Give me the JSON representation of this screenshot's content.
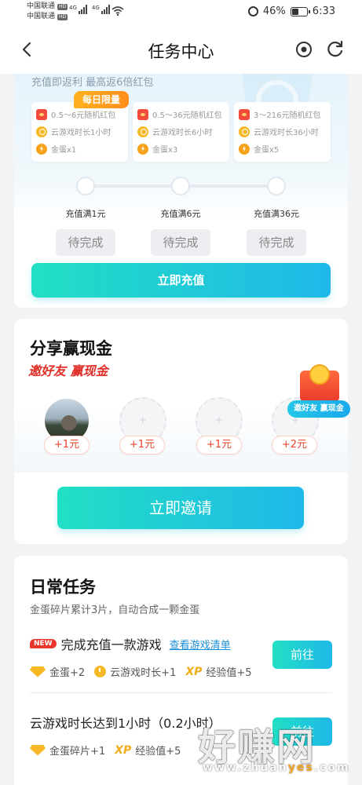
{
  "status_bar": {
    "carrier1": "中国联通",
    "carrier2": "中国联通",
    "hd": "HD",
    "net1": "4G",
    "net2": "4G",
    "battery_percent": "46%",
    "battery_level": 0.46,
    "time": "6:33"
  },
  "nav": {
    "title": "任务中心",
    "back_icon": "chevron-left-icon",
    "target_icon": "target-icon",
    "refresh_icon": "refresh-icon"
  },
  "recharge": {
    "subtitle": "充值即返利 最高返6倍红包",
    "daily_badge": "每日限量",
    "tiers": [
      {
        "red_packet": "0.5～6元随机红包",
        "cloud_time": "云游戏时长1小时",
        "eggs": "金蛋x1",
        "condition": "充值满1元",
        "status": "待完成"
      },
      {
        "red_packet": "0.5～36元随机红包",
        "cloud_time": "云游戏时长6小时",
        "eggs": "金蛋x3",
        "condition": "充值满6元",
        "status": "待完成"
      },
      {
        "red_packet": "3～216元随机红包",
        "cloud_time": "云游戏时长36小时",
        "eggs": "金蛋x5",
        "condition": "充值满36元",
        "status": "待完成"
      }
    ],
    "cta": "立即充值"
  },
  "share": {
    "title": "分享赢现金",
    "slogan": "邀好友 赢现金",
    "slots": [
      {
        "reward": "+1元",
        "filled": true
      },
      {
        "reward": "+1元",
        "filled": false
      },
      {
        "reward": "+1元",
        "filled": false
      },
      {
        "reward": "+2元",
        "filled": false
      }
    ],
    "promo_badge": "邀好友 赢现金",
    "cta": "立即邀请"
  },
  "daily": {
    "title": "日常任务",
    "subtitle": "金蛋碎片累计3片，自动合成一颗金蛋",
    "tasks": [
      {
        "tag": "NEW",
        "title": "完成充值一款游戏",
        "link": "查看游戏清单",
        "rewards": [
          "金蛋+2",
          "云游戏时长+1",
          "经验值+5"
        ],
        "button": "前往"
      },
      {
        "title": "云游戏时长达到1小时（0.2小时）",
        "rewards": [
          "金蛋碎片+1",
          "经验值+5"
        ],
        "button": "前往"
      }
    ],
    "xp_label": "XP"
  },
  "watermark": {
    "main": "好赚网",
    "url_prefix": "www.zhuan",
    "url_highlight": "yes",
    "url_suffix": ".com"
  },
  "colors": {
    "accent_start": "#21dfc4",
    "accent_end": "#1fb8e9",
    "red": "#e8372a",
    "gold": "#f6b824"
  }
}
